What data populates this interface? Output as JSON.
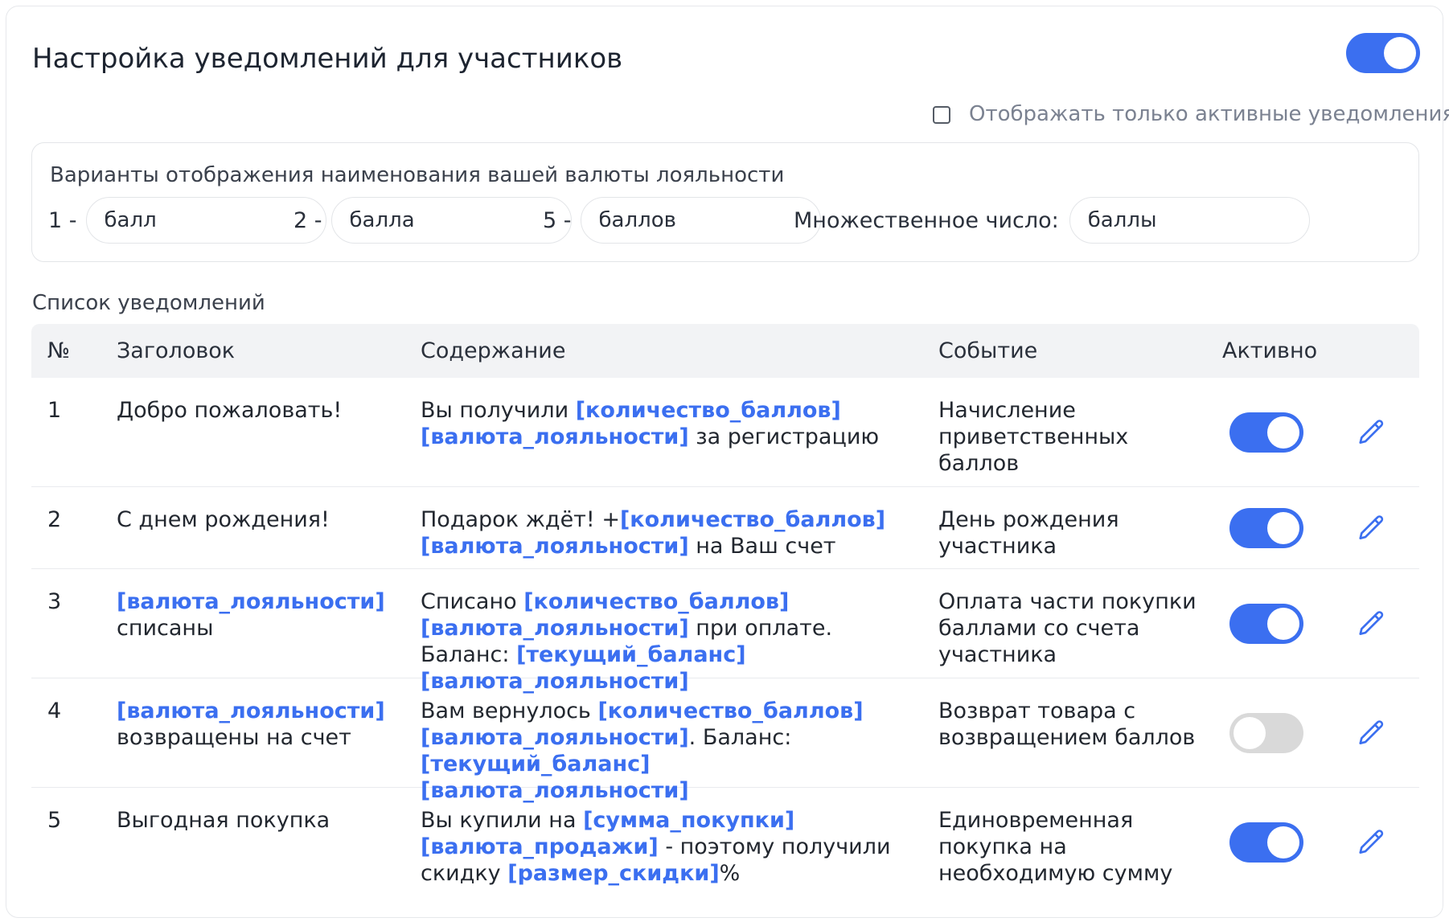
{
  "header": {
    "title": "Настройка уведомлений для участников",
    "enabled": true,
    "filter_label": "Отображать только активные уведомления",
    "filter_checked": false
  },
  "currency": {
    "title": "Варианты отображения наименования вашей валюты лояльности",
    "forms": [
      {
        "label": "1 -",
        "value": "балл"
      },
      {
        "label": "2 -",
        "value": "балла"
      },
      {
        "label": "5 -",
        "value": "баллов"
      },
      {
        "label": "Множественное число:",
        "value": "баллы"
      }
    ]
  },
  "list": {
    "title": "Список уведомлений",
    "columns": {
      "num": "№",
      "title": "Заголовок",
      "content": "Содержание",
      "event": "Событие",
      "active": "Активно"
    },
    "rows": [
      {
        "num": "1",
        "title": [
          {
            "text": "Добро пожаловать!"
          }
        ],
        "content": [
          {
            "text": "Вы получили "
          },
          {
            "text": "[количество_баллов]",
            "var": true
          },
          {
            "text": " "
          },
          {
            "text": "[валюта_лояльности]",
            "var": true
          },
          {
            "text": " за регистрацию"
          }
        ],
        "event": "Начисление приветственных баллов",
        "active": true
      },
      {
        "num": "2",
        "title": [
          {
            "text": "С днем рождения!"
          }
        ],
        "content": [
          {
            "text": "Подарок ждёт! +"
          },
          {
            "text": "[количество_баллов]",
            "var": true
          },
          {
            "text": " "
          },
          {
            "text": "[валюта_лояльности]",
            "var": true
          },
          {
            "text": " на Ваш счет"
          }
        ],
        "event": "День рождения участника",
        "active": true
      },
      {
        "num": "3",
        "title": [
          {
            "text": "[валюта_лояльности]",
            "var": true
          },
          {
            "text": " списаны"
          }
        ],
        "content": [
          {
            "text": "Списано "
          },
          {
            "text": "[количество_баллов]",
            "var": true
          },
          {
            "text": " "
          },
          {
            "text": "[валюта_лояльности]",
            "var": true
          },
          {
            "text": " при оплате. Баланс: "
          },
          {
            "text": "[текущий_баланс]",
            "var": true
          },
          {
            "text": " "
          },
          {
            "text": "[валюта_лояльности]",
            "var": true
          }
        ],
        "event": "Оплата части покупки баллами со счета участника",
        "active": true
      },
      {
        "num": "4",
        "title": [
          {
            "text": "[валюта_лояльности]",
            "var": true
          },
          {
            "text": " возвращены на счет"
          }
        ],
        "content": [
          {
            "text": "Вам вернулось "
          },
          {
            "text": "[количество_баллов]",
            "var": true
          },
          {
            "text": " "
          },
          {
            "text": "[валюта_лояльности]",
            "var": true
          },
          {
            "text": ". Баланс: "
          },
          {
            "text": "[текущий_баланс]",
            "var": true
          },
          {
            "text": " "
          },
          {
            "text": "[валюта_лояльности]",
            "var": true
          }
        ],
        "event": "Возврат товара с возвращением баллов",
        "active": false
      },
      {
        "num": "5",
        "title": [
          {
            "text": "Выгодная покупка"
          }
        ],
        "content": [
          {
            "text": "Вы купили на "
          },
          {
            "text": "[сумма_покупки]",
            "var": true
          },
          {
            "text": " "
          },
          {
            "text": "[валюта_продажи]",
            "var": true
          },
          {
            "text": " - поэтому получили скидку "
          },
          {
            "text": "[размер_скидки]",
            "var": true
          },
          {
            "text": "%"
          }
        ],
        "event": "Единовременная покупка на необходимую сумму",
        "active": true
      }
    ]
  },
  "colors": {
    "accent": "#3b6ff0",
    "toggle_off": "#d9d9d9",
    "header_bg": "#f2f3f5"
  },
  "icons": {
    "edit": "pencil-icon"
  }
}
